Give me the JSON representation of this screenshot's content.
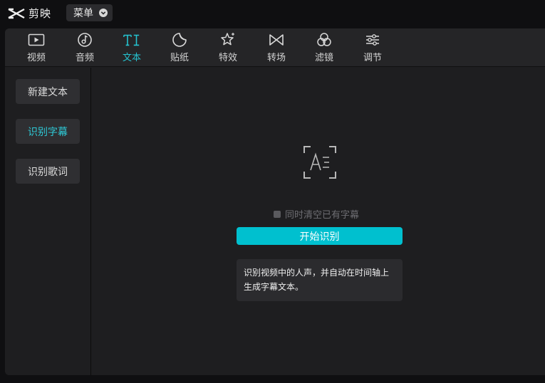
{
  "app": {
    "name": "剪映",
    "menu_label": "菜单"
  },
  "tabs": [
    {
      "label": "视频",
      "icon": "video-icon"
    },
    {
      "label": "音频",
      "icon": "audio-icon"
    },
    {
      "label": "文本",
      "icon": "text-icon",
      "active": true
    },
    {
      "label": "贴纸",
      "icon": "sticker-icon"
    },
    {
      "label": "特效",
      "icon": "effects-icon"
    },
    {
      "label": "转场",
      "icon": "transition-icon"
    },
    {
      "label": "滤镜",
      "icon": "filter-icon"
    },
    {
      "label": "调节",
      "icon": "adjust-icon"
    }
  ],
  "sidebar": {
    "items": [
      {
        "label": "新建文本"
      },
      {
        "label": "识别字幕",
        "active": true
      },
      {
        "label": "识别歌词"
      }
    ]
  },
  "main": {
    "icon": "subtitle-recognition-icon",
    "checkbox_label": "同时清空已有字幕",
    "checkbox_checked": false,
    "start_button": "开始识别",
    "hint": "识别视频中的人声，并自动在时间轴上生成字幕文本。"
  },
  "colors": {
    "accent": "#00c0cf",
    "active_text": "#25c3d0",
    "panel": "#1e1e20",
    "background": "#0f0f11"
  }
}
